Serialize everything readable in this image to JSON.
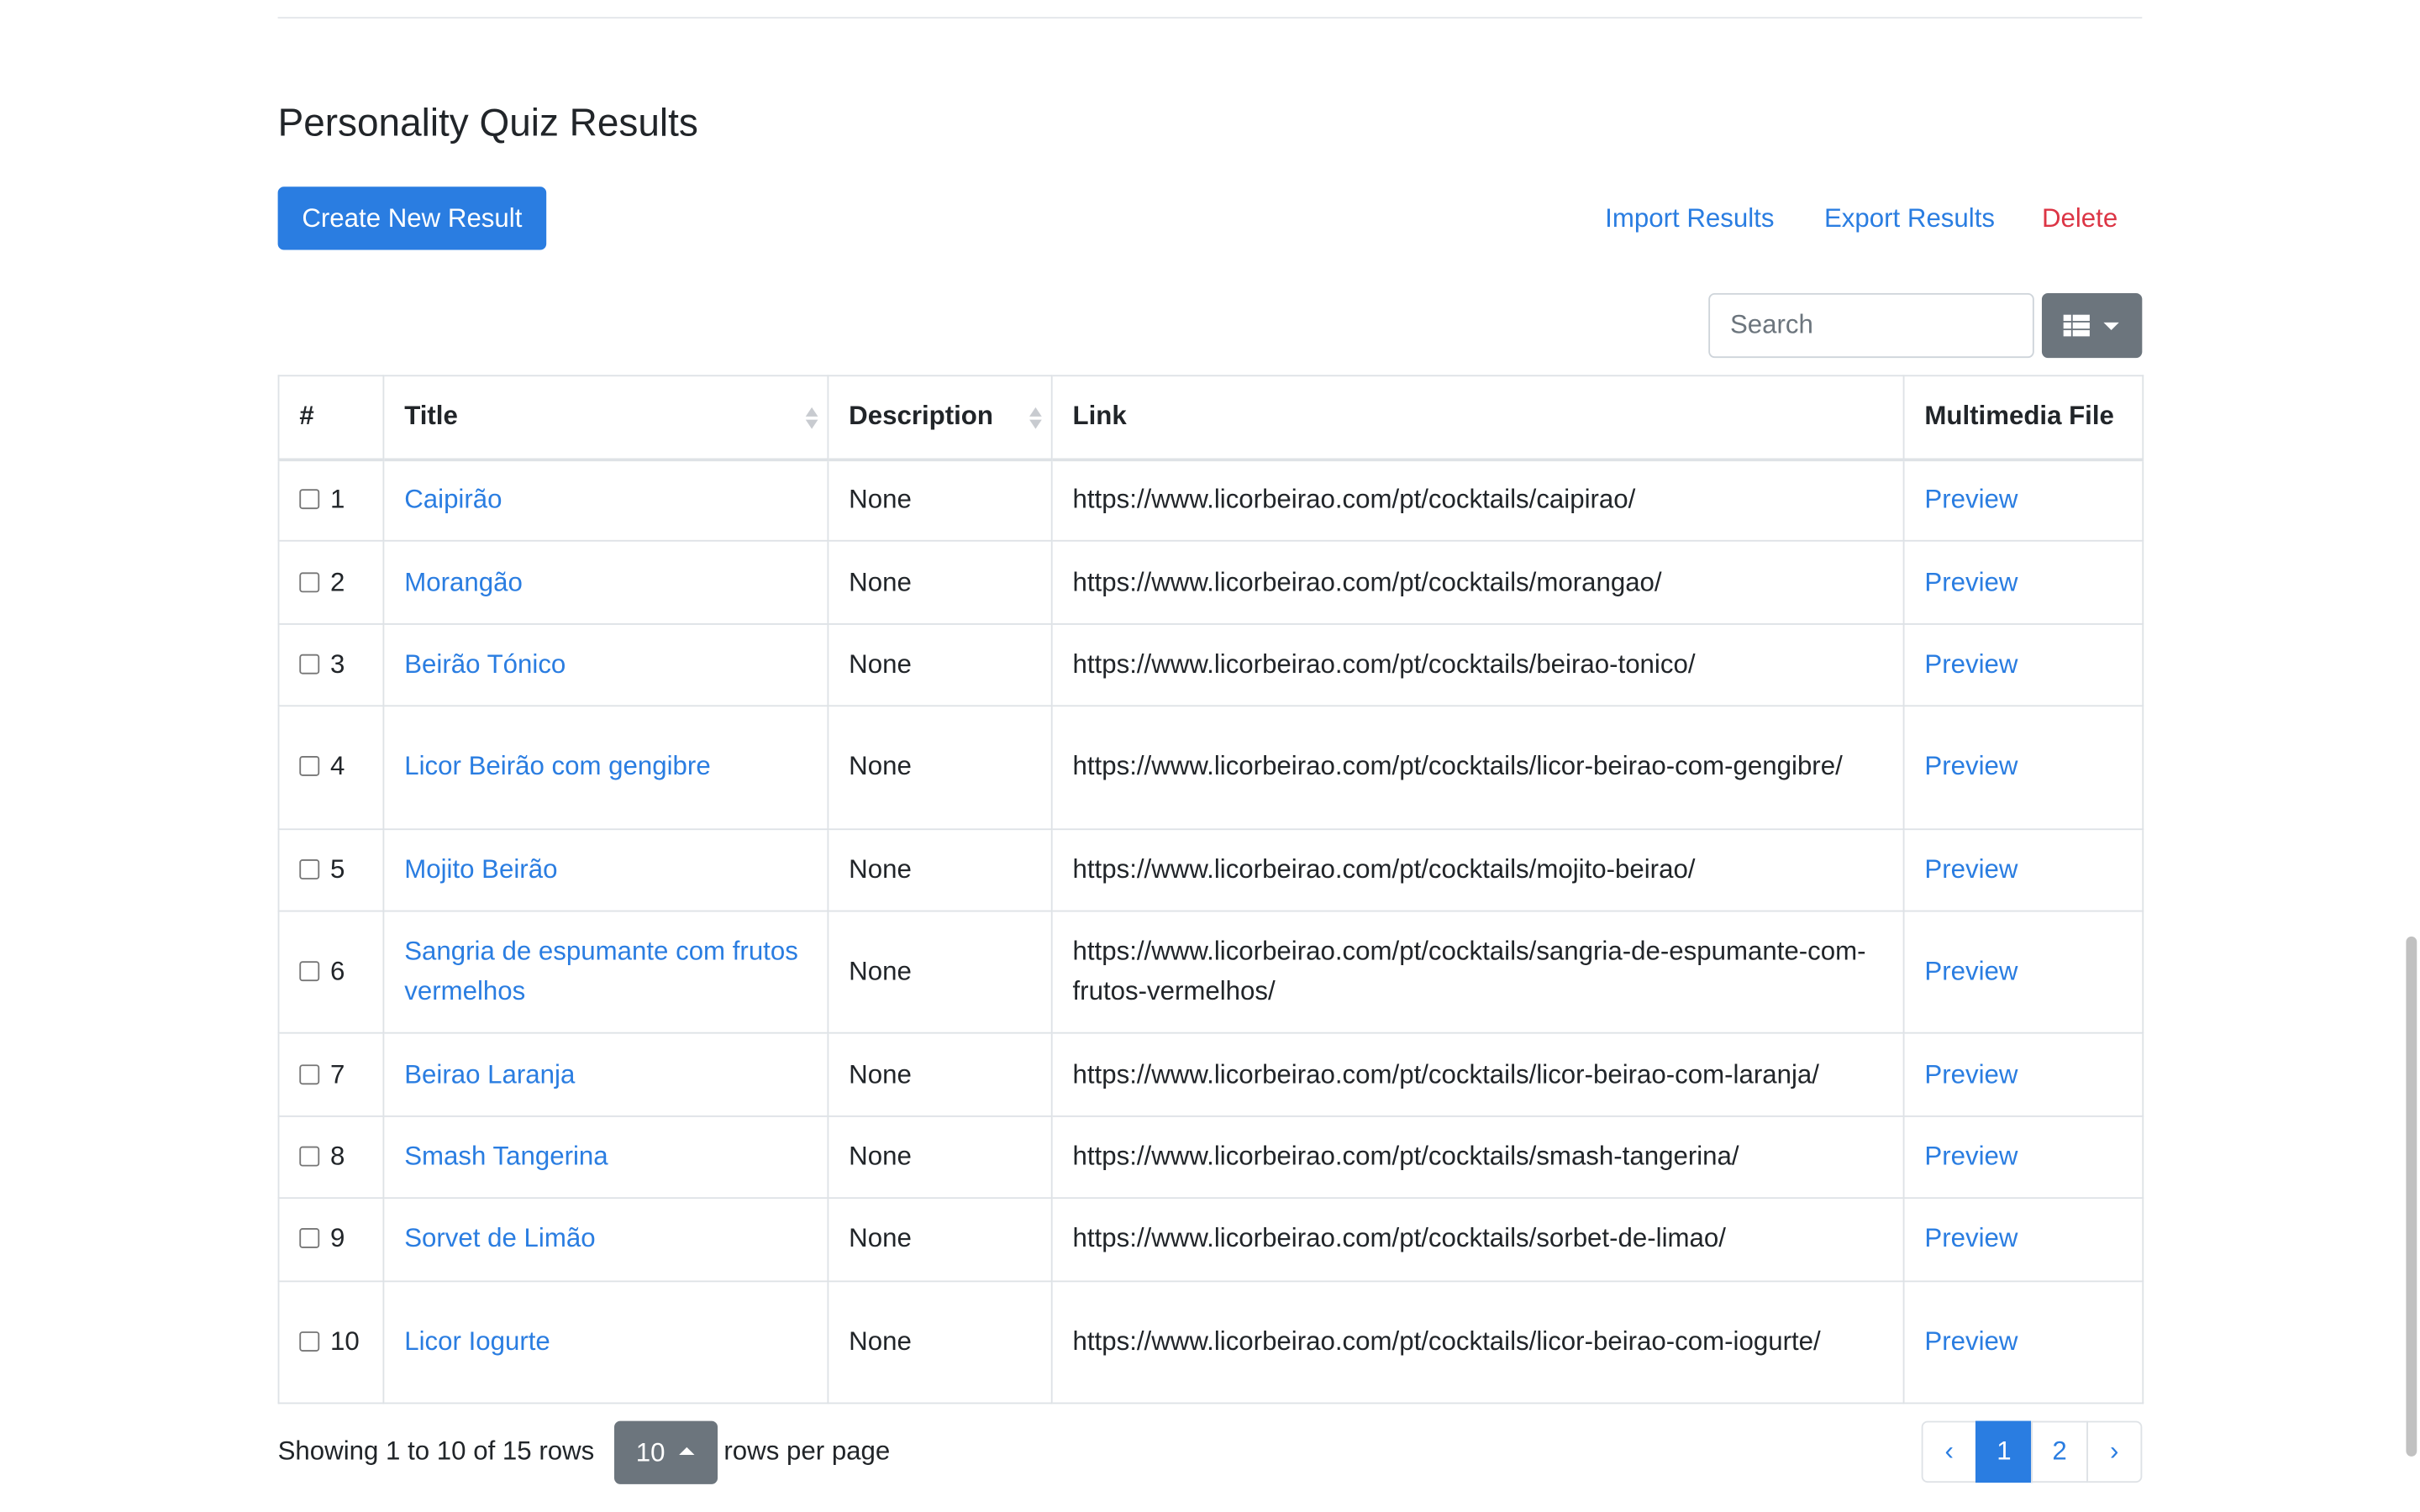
{
  "page": {
    "title": "Personality Quiz Results",
    "accent_color": "#2a7de1",
    "danger_color": "#dc3545"
  },
  "toolbar": {
    "create_label": "Create New Result",
    "import_label": "Import Results",
    "export_label": "Export Results",
    "delete_label": "Delete",
    "search_placeholder": "Search",
    "view_icon": "list-icon"
  },
  "table": {
    "columns": [
      "#",
      "Title",
      "Description",
      "Link",
      "Multimedia File"
    ],
    "rows": [
      {
        "num": "1",
        "title": "Caipirão",
        "description": "None",
        "link": "https://www.licorbeirao.com/pt/cocktails/caipirao/",
        "media": "Preview"
      },
      {
        "num": "2",
        "title": "Morangão",
        "description": "None",
        "link": "https://www.licorbeirao.com/pt/cocktails/morangao/",
        "media": "Preview"
      },
      {
        "num": "3",
        "title": "Beirão Tónico",
        "description": "None",
        "link": "https://www.licorbeirao.com/pt/cocktails/beirao-tonico/",
        "media": "Preview"
      },
      {
        "num": "4",
        "title": "Licor Beirão com gengibre",
        "description": "None",
        "link": "https://www.licorbeirao.com/pt/cocktails/licor-beirao-com-gengibre/",
        "media": "Preview"
      },
      {
        "num": "5",
        "title": "Mojito Beirão",
        "description": "None",
        "link": "https://www.licorbeirao.com/pt/cocktails/mojito-beirao/",
        "media": "Preview"
      },
      {
        "num": "6",
        "title": "Sangria de espumante com frutos vermelhos",
        "description": "None",
        "link": "https://www.licorbeirao.com/pt/cocktails/sangria-de-espumante-com-frutos-vermelhos/",
        "media": "Preview"
      },
      {
        "num": "7",
        "title": "Beirao Laranja",
        "description": "None",
        "link": "https://www.licorbeirao.com/pt/cocktails/licor-beirao-com-laranja/",
        "media": "Preview"
      },
      {
        "num": "8",
        "title": "Smash Tangerina",
        "description": "None",
        "link": "https://www.licorbeirao.com/pt/cocktails/smash-tangerina/",
        "media": "Preview"
      },
      {
        "num": "9",
        "title": "Sorvet de Limão",
        "description": "None",
        "link": "https://www.licorbeirao.com/pt/cocktails/sorbet-de-limao/",
        "media": "Preview"
      },
      {
        "num": "10",
        "title": "Licor Iogurte",
        "description": "None",
        "link": "https://www.licorbeirao.com/pt/cocktails/licor-beirao-com-iogurte/",
        "media": "Preview"
      }
    ]
  },
  "footer": {
    "showing_text": "Showing 1 to 10 of 15 rows",
    "page_size": "10",
    "rows_per_page_label": "rows per page",
    "pages": [
      "‹",
      "1",
      "2",
      "›"
    ],
    "current_page": "1"
  }
}
